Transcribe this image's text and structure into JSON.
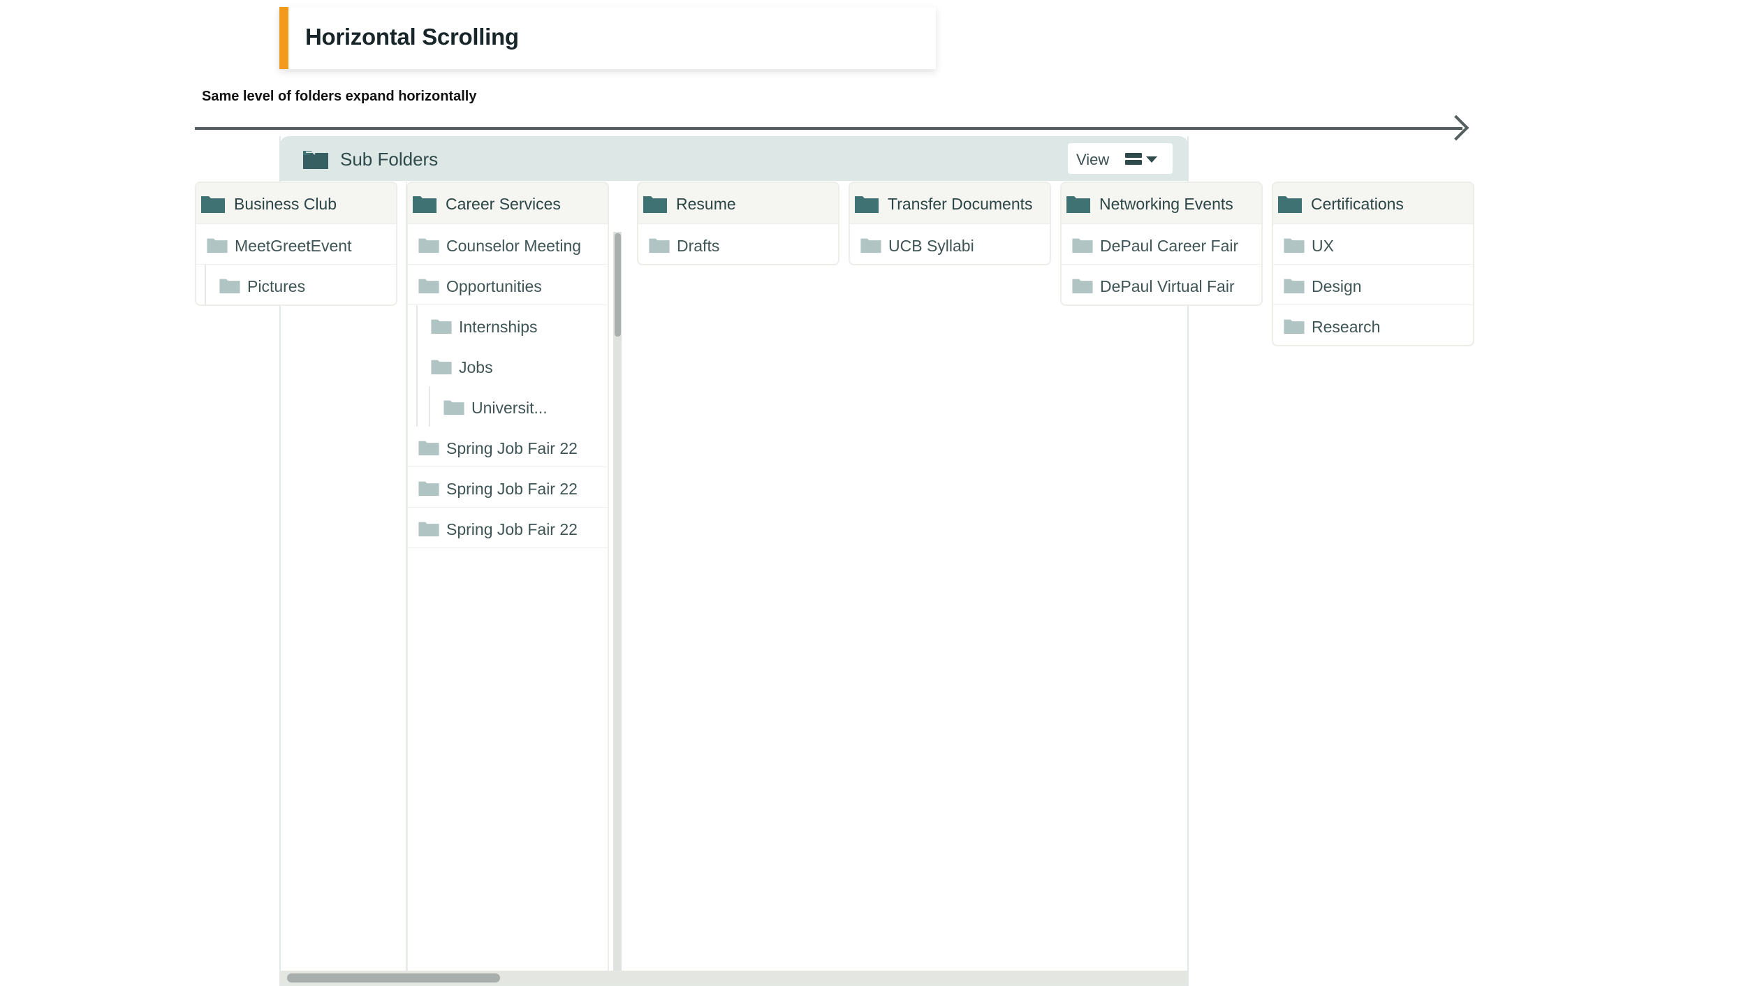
{
  "title": {
    "text": "Horizontal Scrolling",
    "accent_color": "#f39a1c"
  },
  "subtitle": "Same level of folders expand horizontally",
  "panel": {
    "header_title": "Sub Folders",
    "header_icon": "folder-open-icon",
    "view_label": "View",
    "view_icon": "list-view-icon",
    "header_bg": "#dde7e6"
  },
  "colors": {
    "folder_dark": "#3f7273",
    "folder_light": "#b1c4c4"
  },
  "columns": [
    {
      "title": "Business Club",
      "rows": [
        {
          "label": "MeetGreetEvent",
          "depth": 0
        },
        {
          "label": "Pictures",
          "depth": 1
        }
      ]
    },
    {
      "title": "Career Services",
      "rows": [
        {
          "label": "Counselor Meeting",
          "depth": 0
        },
        {
          "label": "Opportunities",
          "depth": 0
        },
        {
          "label": "Internships",
          "depth": 1
        },
        {
          "label": "Jobs",
          "depth": 1
        },
        {
          "label": "Universit...",
          "depth": 2
        },
        {
          "label": "Spring Job Fair 22",
          "depth": 0
        },
        {
          "label": "Spring Job Fair 22",
          "depth": 0
        },
        {
          "label": "Spring Job Fair 22",
          "depth": 0
        }
      ]
    },
    {
      "title": "Resume",
      "rows": [
        {
          "label": "Drafts",
          "depth": 0
        }
      ]
    },
    {
      "title": "Transfer Documents",
      "rows": [
        {
          "label": "UCB Syllabi",
          "depth": 0
        }
      ]
    },
    {
      "title": "Networking Events",
      "rows": [
        {
          "label": "DePaul Career Fair",
          "depth": 0
        },
        {
          "label": "DePaul Virtual Fair",
          "depth": 0
        }
      ]
    },
    {
      "title": "Certifications",
      "rows": [
        {
          "label": "UX",
          "depth": 0
        },
        {
          "label": "Design",
          "depth": 0
        },
        {
          "label": "Research",
          "depth": 0
        }
      ]
    }
  ]
}
